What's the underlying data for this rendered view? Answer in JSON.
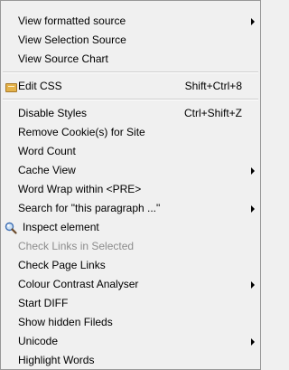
{
  "menu": {
    "items": [
      {
        "label": "View formatted source",
        "shortcut": "",
        "submenu": true
      },
      {
        "label": "View Selection Source",
        "shortcut": "",
        "submenu": false
      },
      {
        "label": "View Source Chart",
        "shortcut": "",
        "submenu": false
      },
      {
        "label": "Edit CSS",
        "shortcut": "Shift+Ctrl+8",
        "submenu": false,
        "icon": "css-icon"
      },
      {
        "label": "Disable Styles",
        "shortcut": "Ctrl+Shift+Z",
        "submenu": false
      },
      {
        "label": "Remove Cookie(s) for Site",
        "shortcut": "",
        "submenu": false
      },
      {
        "label": "Word Count",
        "shortcut": "",
        "submenu": false
      },
      {
        "label": "Cache View",
        "shortcut": "",
        "submenu": true
      },
      {
        "label": "Word Wrap within <PRE>",
        "shortcut": "",
        "submenu": false
      },
      {
        "label": "Search for \"this paragraph ...\"",
        "shortcut": "",
        "submenu": true
      },
      {
        "label": "Inspect element",
        "shortcut": "",
        "submenu": false,
        "icon": "magnifier-icon"
      },
      {
        "label": "Check Links in Selected",
        "shortcut": "",
        "submenu": false,
        "disabled": true
      },
      {
        "label": "Check Page Links",
        "shortcut": "",
        "submenu": false
      },
      {
        "label": "Colour Contrast Analyser",
        "shortcut": "",
        "submenu": true
      },
      {
        "label": "Start DIFF",
        "shortcut": "",
        "submenu": false
      },
      {
        "label": "Show hidden Fileds",
        "shortcut": "",
        "submenu": false
      },
      {
        "label": "Unicode",
        "shortcut": "",
        "submenu": true
      },
      {
        "label": "Highlight Words",
        "shortcut": "",
        "submenu": false
      }
    ]
  }
}
